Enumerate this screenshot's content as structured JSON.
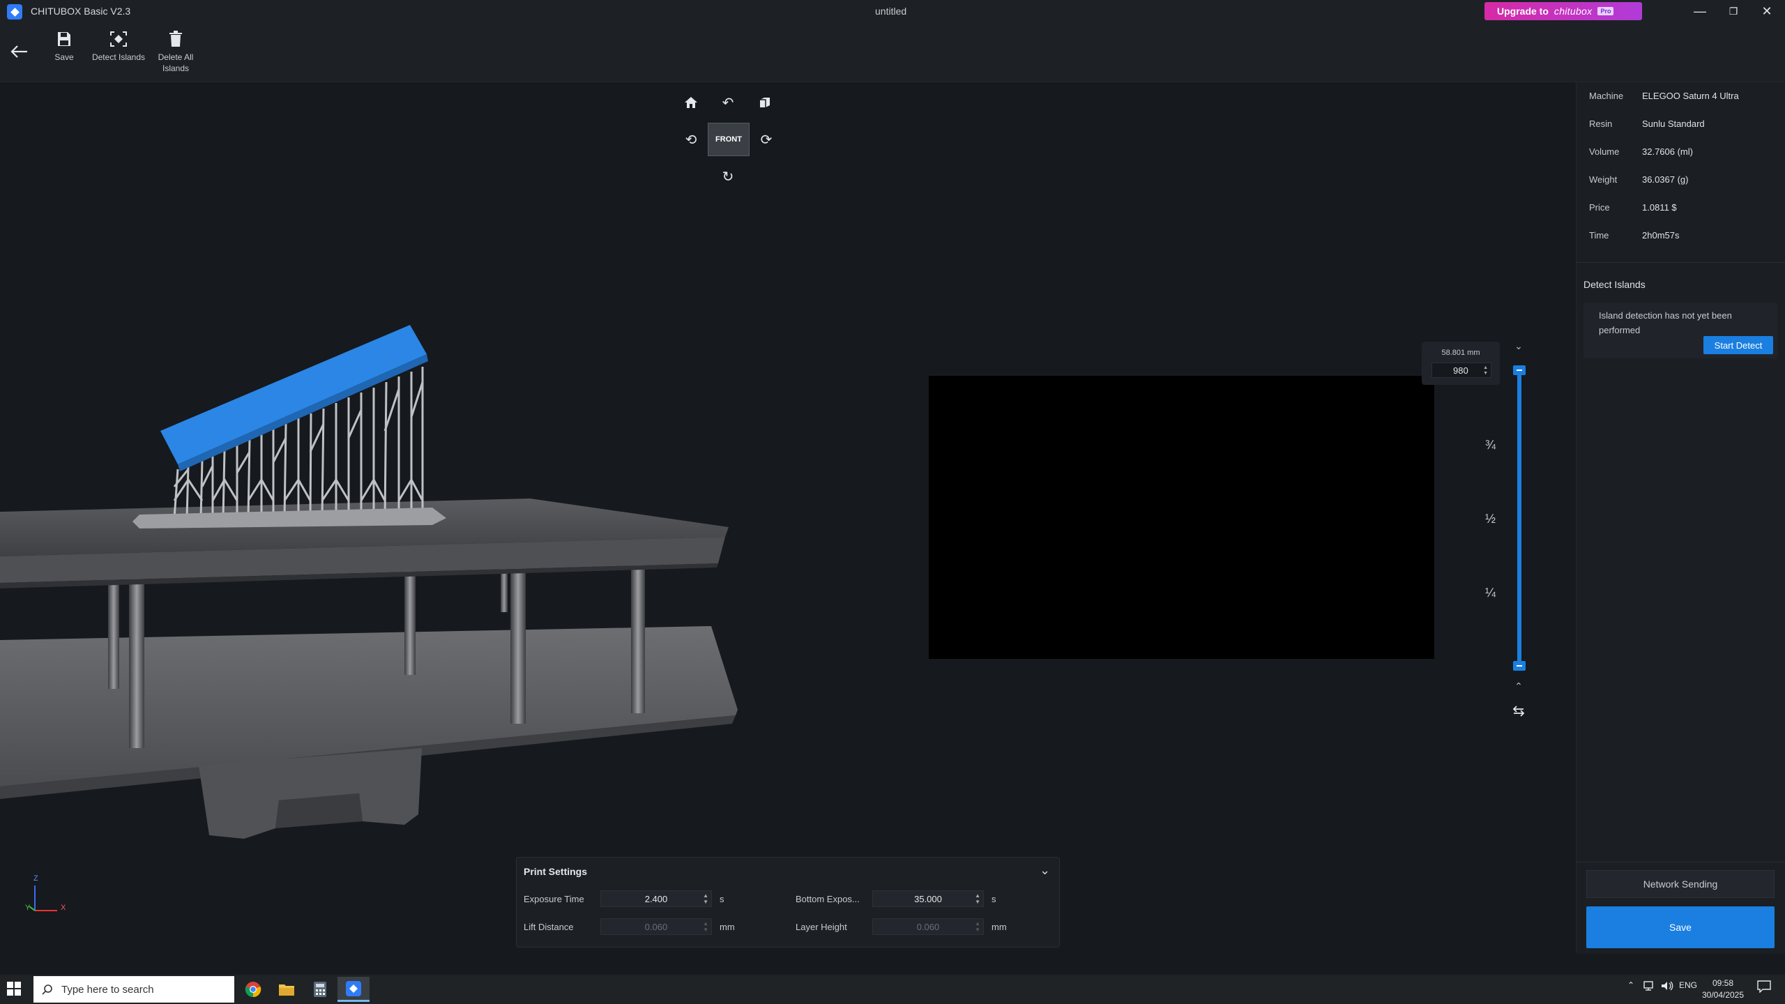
{
  "app": {
    "title": "CHITUBOX Basic V2.3",
    "document": "untitled"
  },
  "upgrade": {
    "label": "Upgrade to",
    "brand": "chitubox",
    "tag": "Pro"
  },
  "toolbar": {
    "save_label": "Save",
    "detect_islands_label": "Detect Islands",
    "delete_all_label": "Delete All Islands"
  },
  "view": {
    "front_label": "FRONT",
    "axis_z": "Z",
    "axis_x": "X",
    "axis_y": "Y"
  },
  "slider": {
    "height_mm": "58.801 mm",
    "layer": "980",
    "marks": [
      "¾",
      "½",
      "¼"
    ]
  },
  "print_settings": {
    "title": "Print Settings",
    "exposure_label": "Exposure Time",
    "exposure_value": "2.400",
    "exposure_unit": "s",
    "bottom_exposure_label": "Bottom Expos...",
    "bottom_exposure_value": "35.000",
    "bottom_exposure_unit": "s",
    "lift_label": "Lift Distance",
    "lift_value": "0.060",
    "lift_unit": "mm",
    "layer_height_label": "Layer Height",
    "layer_height_value": "0.060",
    "layer_height_unit": "mm"
  },
  "info": {
    "machine_label": "Machine",
    "machine": "ELEGOO Saturn 4 Ultra",
    "resin_label": "Resin",
    "resin": "Sunlu Standard",
    "volume_label": "Volume",
    "volume": "32.7606 (ml)",
    "weight_label": "Weight",
    "weight": "36.0367 (g)",
    "price_label": "Price",
    "price": "1.0811 $",
    "time_label": "Time",
    "time": "2h0m57s"
  },
  "detect": {
    "title": "Detect Islands",
    "message": "Island detection has not yet been performed",
    "button": "Start Detect"
  },
  "actions": {
    "network": "Network Sending",
    "save": "Save"
  },
  "taskbar": {
    "search_placeholder": "Type here to search",
    "lang": "ENG",
    "time": "09:58",
    "date": "30/04/2025"
  },
  "colors": {
    "accent": "#1a7fe0",
    "model_top": "#2b86e6",
    "upgrade": "#c832b8"
  }
}
